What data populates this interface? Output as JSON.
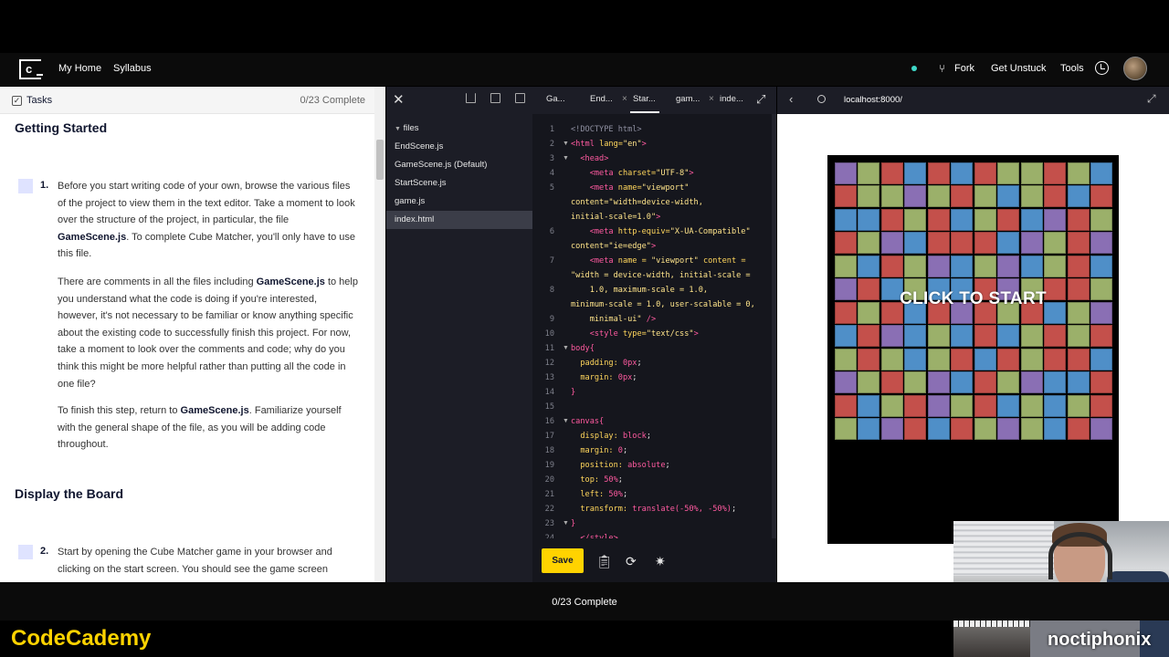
{
  "nav": {
    "logo_glyph": "c",
    "my_home": "My Home",
    "syllabus": "Syllabus",
    "fork": "Fork",
    "get_unstuck": "Get Unstuck",
    "tools": "Tools"
  },
  "tasks": {
    "title": "Tasks",
    "progress": "0/23 Complete",
    "section1_title": "Getting Started",
    "task1_num": "1.",
    "task1_p1_a": "Before you start writing code of your own, browse the various files of the project to view them in the text editor. Take a moment to look over the structure of the project, in particular, the file ",
    "task1_p1_file": "GameScene.js",
    "task1_p1_b": ". To complete Cube Matcher, you'll only have to use this file.",
    "task1_p2_a": "There are comments in all the files including ",
    "task1_p2_file": "GameScene.js",
    "task1_p2_b": " to help you understand what the code is doing if you're interested, however, it's not necessary to be familiar or know anything specific about the existing code to successfully finish this project. For now, take a moment to look over the comments and code; why do you think this might be more helpful rather than putting all the code in one file?",
    "task1_p3_a": "To finish this step, return to ",
    "task1_p3_file": "GameScene.js",
    "task1_p3_b": ". Familiarize yourself with the general shape of the file, as you will be adding code throughout.",
    "section2_title": "Display the Board",
    "task2_num": "2.",
    "task2_p1": "Start by opening the Cube Matcher game in your browser and clicking on the start screen. You should see the game screen"
  },
  "editor": {
    "folder": "files",
    "files": [
      "EndScene.js",
      "GameScene.js (Default)",
      "StartScene.js",
      "game.js",
      "index.html"
    ],
    "tabs": [
      "Ga...",
      "End...",
      "Star...",
      "gam...",
      "inde..."
    ],
    "save_label": "Save",
    "code_lines": [
      {
        "n": "1",
        "html": "<span class='cm'>&lt;!DOCTYPE html&gt;</span>"
      },
      {
        "n": "2",
        "html": "<span class='tg'>&lt;html</span> <span class='at'>lang=</span><span class='st'>\"en\"</span><span class='tg'>&gt;</span>"
      },
      {
        "n": "3",
        "html": "  <span class='tg'>&lt;head&gt;</span>"
      },
      {
        "n": "4",
        "html": "    <span class='tg'>&lt;meta</span> <span class='at'>charset=</span><span class='st'>\"UTF-8\"</span><span class='tg'>&gt;</span>"
      },
      {
        "n": "5",
        "html": "    <span class='tg'>&lt;meta</span> <span class='at'>name=</span><span class='st'>\"viewport\"</span>"
      },
      {
        "n": "",
        "html": "<span class='st'>content=\"width=device-width,</span>"
      },
      {
        "n": "",
        "html": "<span class='st'>initial-scale=1.0\"</span><span class='tg'>&gt;</span>"
      },
      {
        "n": "6",
        "html": "    <span class='tg'>&lt;meta</span> <span class='at'>http-equiv=</span><span class='st'>\"X-UA-Compatible\"</span>"
      },
      {
        "n": "",
        "html": "<span class='st'>content=\"ie=edge\"</span><span class='tg'>&gt;</span>"
      },
      {
        "n": "7",
        "html": "    <span class='tg'>&lt;meta</span> <span class='at'>name =</span> <span class='st'>\"viewport\"</span> <span class='at'>content =</span>"
      },
      {
        "n": "",
        "html": "<span class='st'>\"width = device-width, initial-scale =</span>"
      },
      {
        "n": "8",
        "html": "<span class='st'>    1.0, maximum-scale = 1.0,</span>"
      },
      {
        "n": "",
        "html": "<span class='st'>minimum-scale = 1.0, user-scalable = 0,</span>"
      },
      {
        "n": "9",
        "html": "<span class='st'>    minimal-ui\"</span> <span class='tg'>/&gt;</span>"
      },
      {
        "n": "10",
        "html": "    <span class='tg'>&lt;style</span> <span class='at'>type=</span><span class='st'>\"text/css\"</span><span class='tg'>&gt;</span>"
      },
      {
        "n": "11",
        "html": "<span class='tg'>body{</span>"
      },
      {
        "n": "12",
        "html": "  <span class='pr'>padding:</span> <span class='vl'>0px</span>;"
      },
      {
        "n": "13",
        "html": "  <span class='pr'>margin:</span> <span class='vl'>0px</span>;"
      },
      {
        "n": "14",
        "html": "<span class='tg'>}</span>"
      },
      {
        "n": "15",
        "html": ""
      },
      {
        "n": "16",
        "html": "<span class='tg'>canvas{</span>"
      },
      {
        "n": "17",
        "html": "  <span class='pr'>display:</span> <span class='vl'>block</span>;"
      },
      {
        "n": "18",
        "html": "  <span class='pr'>margin:</span> <span class='vl'>0</span>;"
      },
      {
        "n": "19",
        "html": "  <span class='pr'>position:</span> <span class='vl'>absolute</span>;"
      },
      {
        "n": "20",
        "html": "  <span class='pr'>top:</span> <span class='vl'>50%</span>;"
      },
      {
        "n": "21",
        "html": "  <span class='pr'>left:</span> <span class='vl'>50%</span>;"
      },
      {
        "n": "22",
        "html": "  <span class='pr'>transform:</span> <span class='vl'>translate(-50%, -50%)</span>;"
      },
      {
        "n": "23",
        "html": "<span class='tg'>}</span>"
      },
      {
        "n": "24",
        "html": "  <span class='tg'>&lt;/style&gt;</span>"
      }
    ]
  },
  "browser": {
    "url": "localhost:8000/"
  },
  "game": {
    "start_text": "CLICK TO START",
    "colors": {
      "purple": "#8a6fb4",
      "green": "#9bb06a",
      "red": "#c4504b",
      "blue": "#4f8fc8"
    },
    "grid": [
      "PGRBRBRGGRGB",
      "RGGPGRGBGRBR",
      "BBRGRBGRBPRG",
      "RGPBRRRBPGRP",
      "GBRGPBGPBGRB",
      "PRBGBBRPGRRG",
      "RGRBRPRGRBGP",
      "BRPBGBRBGRGR",
      "GRGBGRBRGRRB",
      "PGRGPBRGPBBR",
      "RBGRPGRBGBGR",
      "GBPRBRGPGBRP"
    ]
  },
  "footer": {
    "progress": "0/23 Complete",
    "brand": "CodeCademy",
    "watermark": "noctiphonix"
  }
}
